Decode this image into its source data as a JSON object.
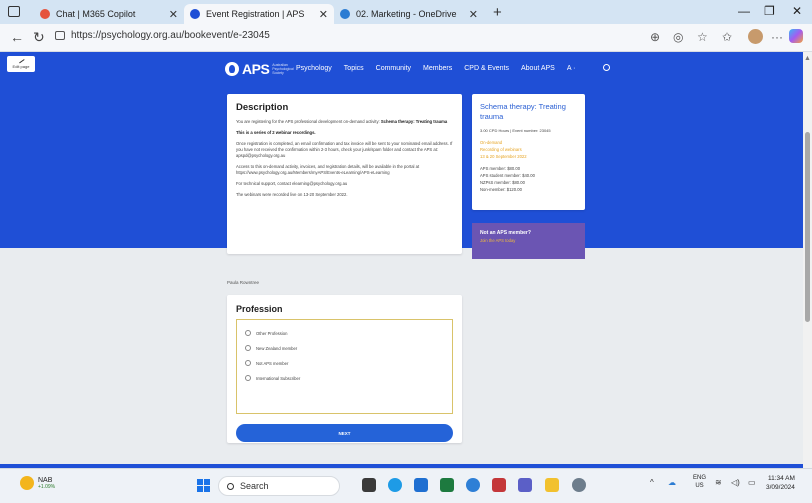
{
  "browser": {
    "tabs": [
      {
        "title": "Chat | M365 Copilot",
        "favicon_color": "#e5533d"
      },
      {
        "title": "Event Registration | APS",
        "favicon_color": "#1f4fd6"
      },
      {
        "title": "02. Marketing - OneDrive",
        "favicon_color": "#2b7cd3"
      }
    ],
    "new_tab_icon": "plus-icon",
    "url": "https://psychology.org.au/bookevent/e-23045",
    "window_controls": [
      "—",
      "❐",
      "✕"
    ]
  },
  "site": {
    "logo_text": "APS",
    "logo_sub": "Australian Psychological Society",
    "nav": [
      "Psychology",
      "Topics",
      "Community",
      "Members",
      "CPD & Events",
      "About APS",
      "A ·"
    ],
    "edit_badge": "Edit page"
  },
  "description": {
    "heading": "Description",
    "intro_prefix": "You are registering for the APS professional development on-demand activity: ",
    "intro_bold": "Schema therapy: Treating trauma",
    "series_note": "This is a series of 2 webinar recordings.",
    "confirmation": "Once registration is completed, an email confirmation and tax invoice will be sent to your nominated email address. If you have not received the confirmation within 2-3 hours, check your junk/spam folder and contact the APS at: apspd@psychology.org.au",
    "access": "Access to this on-demand activity, invoices, and registration details, will be available in the portal at https://www.psychology.org.au/Members/myAPS/Events-eLearning/APS-eLearning",
    "support": "For technical support, contact elearning@psychology.org.au",
    "recorded": "The webinars were recorded live on 13-20 September 2022."
  },
  "summary": {
    "title": "Schema therapy: Treating trauma",
    "meta": "3.00 CPD Hours | Event number: 23045",
    "ondemand_lines": [
      "On-demand",
      "Recording of webinars",
      "13 & 20 September 2022"
    ],
    "prices": [
      "APS member: $80.00",
      "APS student member: $40.00",
      "NZPsS member: $80.00",
      "Non-member: $120.00"
    ]
  },
  "membership": {
    "question": "Not an APS member?",
    "link": "Join the APS today"
  },
  "registrant_name": "Paula Rowntree",
  "profession": {
    "heading": "Profession",
    "options": [
      "Other Profession",
      "New Zealand member",
      "Not APS member",
      "International Subscriber"
    ],
    "next_label": "NEXT"
  },
  "taskbar": {
    "weather_label": "NAB",
    "weather_change": "+1.09%",
    "search_placeholder": "Search",
    "lang_line1": "ENG",
    "lang_line2": "US",
    "time": "11:34 AM",
    "date": "3/09/2024"
  },
  "colors": {
    "aps_blue": "#1f4fd6",
    "membership_purple": "#6b55b3",
    "accent_orange": "#e6a321"
  }
}
